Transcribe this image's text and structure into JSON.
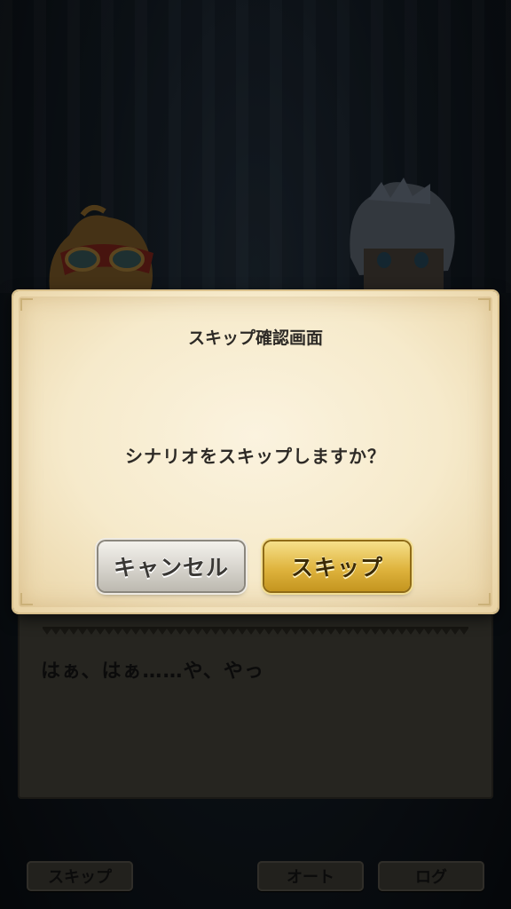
{
  "modal": {
    "title": "スキップ確認画面",
    "message": "シナリオをスキップしますか？",
    "cancel_label": "キャンセル",
    "confirm_label": "スキップ"
  },
  "dialogue": {
    "text": "はぁ、はぁ……や、やっ"
  },
  "bottom_bar": {
    "skip_label": "スキップ",
    "auto_label": "オート",
    "log_label": "ログ"
  },
  "colors": {
    "confirm_gold": "#dfb43e",
    "cancel_gray": "#d9d6cf",
    "parchment": "#f6eacb"
  }
}
